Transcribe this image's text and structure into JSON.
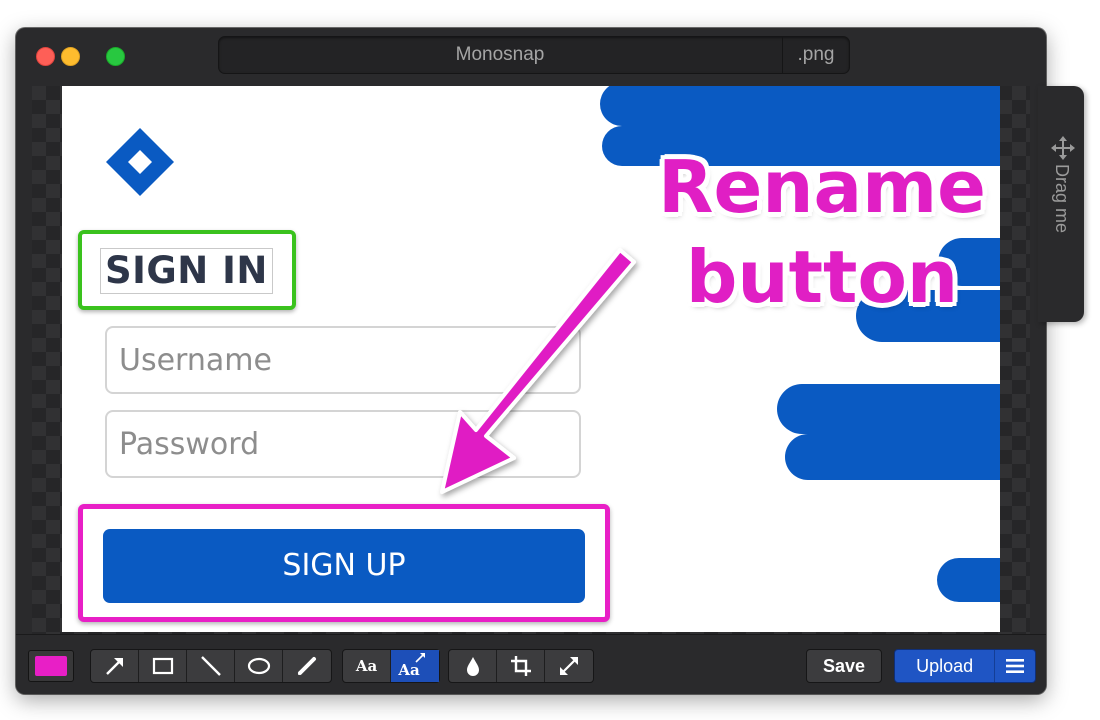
{
  "window": {
    "title": "Monosnap",
    "extension": ".png"
  },
  "drag_tab": {
    "label": "Drag me",
    "icon": "move-arrows-icon"
  },
  "screenshot": {
    "heading": "SIGN IN",
    "username_placeholder": "Username",
    "password_placeholder": "Password",
    "signup_label": "SIGN UP",
    "logo_color": "#0a5ac2",
    "wave_color": "#0a5ac2"
  },
  "annotation": {
    "line1": "Rename",
    "line2": "button",
    "color": "#e01fc4",
    "signin_highlight_color": "#3ac21d",
    "signup_highlight_color": "#e81fc6"
  },
  "toolbar": {
    "current_color": "#e81fc6",
    "drawing_tools": [
      "arrow-icon",
      "rectangle-icon",
      "line-icon",
      "ellipse-icon",
      "pencil-icon"
    ],
    "text_tools": {
      "text_label": "Aa",
      "text_arrow_label": "Aa",
      "active": "text-arrow"
    },
    "image_tools": [
      "blur-drop-icon",
      "crop-icon",
      "resize-icon"
    ],
    "save_label": "Save",
    "upload_label": "Upload",
    "menu_icon": "hamburger-icon"
  }
}
